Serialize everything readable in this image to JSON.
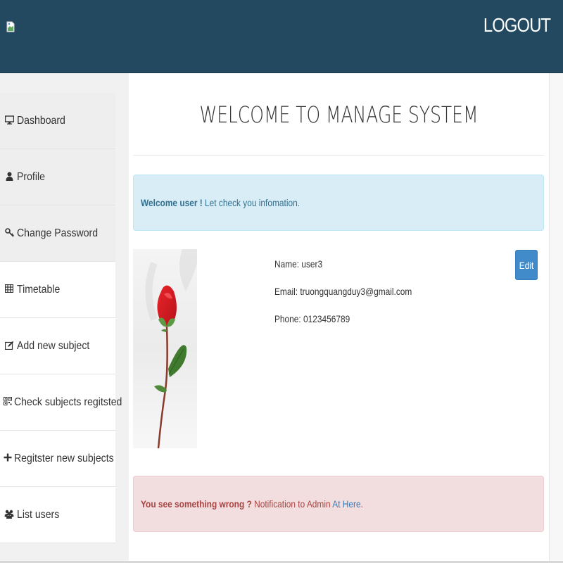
{
  "header": {
    "logout_label": "LOGOUT",
    "logo_icon": "broken-image-icon",
    "background_color": "#22495f"
  },
  "sidebar": {
    "items": [
      {
        "label": "Dashboard",
        "icon": "monitor-icon",
        "glyph": "🖵"
      },
      {
        "label": "Profile",
        "icon": "user-icon",
        "glyph": "👤"
      },
      {
        "label": "Change Password",
        "icon": "key-icon",
        "glyph": "🔑"
      },
      {
        "label": "Timetable",
        "icon": "table-icon",
        "glyph": "▦"
      },
      {
        "label": "Add new subject",
        "icon": "edit-icon",
        "glyph": "✎"
      },
      {
        "label": "Check subjects regitsted",
        "icon": "qrcode-icon",
        "glyph": "▩"
      },
      {
        "label": "Regitster new subjects",
        "icon": "plus-icon",
        "glyph": "+"
      },
      {
        "label": "List users",
        "icon": "users-icon",
        "glyph": "👥"
      }
    ]
  },
  "main": {
    "title": "WELCOME TO MANAGE SYSTEM",
    "welcome_alert": {
      "bold": "Welcome user !",
      "text": " Let check you infomation."
    },
    "profile": {
      "name": "Name: user3",
      "email": "Email: truongquangduy3@gmail.com",
      "phone": "Phone: 0123456789",
      "edit_label": "Edit",
      "photo_icon": "rose-photo"
    },
    "danger_alert": {
      "bold": "You see something wrong ?",
      "text": " Notification to Admin ",
      "link": "At Here",
      "end": "."
    }
  },
  "colors": {
    "accent": "#428bca",
    "info_bg": "#d9edf7",
    "danger_bg": "#f2dede"
  }
}
